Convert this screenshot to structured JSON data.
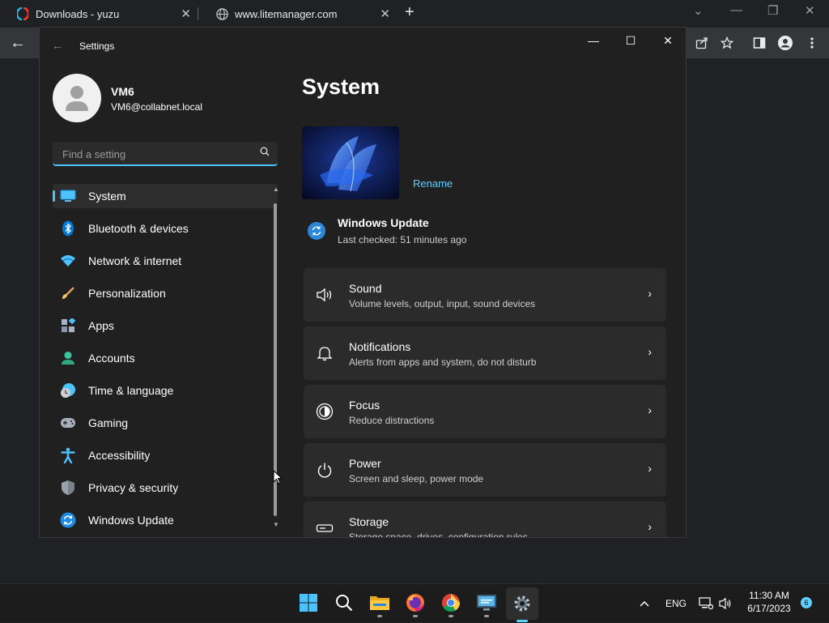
{
  "browser": {
    "tabs": [
      {
        "title": "Downloads - yuzu"
      },
      {
        "title": "www.litemanager.com"
      }
    ],
    "new_tab": "+",
    "window_controls": {
      "dropdown": "⌄",
      "minimize": "—",
      "restore": "❐",
      "close": "✕"
    },
    "tab_close": "✕",
    "back": "←",
    "toolbar_icons": [
      "share-icon",
      "star-icon",
      "sidepanel-icon",
      "profile-icon",
      "menu-icon"
    ]
  },
  "settings": {
    "window_title": "Settings",
    "controls": {
      "minimize": "—",
      "maximize": "☐",
      "close": "✕"
    },
    "user": {
      "name": "VM6",
      "email": "VM6@collabnet.local"
    },
    "search": {
      "placeholder": "Find a setting"
    },
    "nav": [
      {
        "label": "System",
        "icon": "system-icon",
        "active": true
      },
      {
        "label": "Bluetooth & devices",
        "icon": "bluetooth-icon"
      },
      {
        "label": "Network & internet",
        "icon": "network-icon"
      },
      {
        "label": "Personalization",
        "icon": "brush-icon"
      },
      {
        "label": "Apps",
        "icon": "apps-icon"
      },
      {
        "label": "Accounts",
        "icon": "accounts-icon"
      },
      {
        "label": "Time & language",
        "icon": "clock-globe-icon"
      },
      {
        "label": "Gaming",
        "icon": "gamepad-icon"
      },
      {
        "label": "Accessibility",
        "icon": "accessibility-icon"
      },
      {
        "label": "Privacy & security",
        "icon": "shield-icon"
      },
      {
        "label": "Windows Update",
        "icon": "update-icon"
      }
    ],
    "page": {
      "title": "System",
      "rename": "Rename",
      "update": {
        "title": "Windows Update",
        "subtitle": "Last checked: 51 minutes ago"
      },
      "cards": [
        {
          "title": "Sound",
          "subtitle": "Volume levels, output, input, sound devices",
          "icon": "speaker-icon"
        },
        {
          "title": "Notifications",
          "subtitle": "Alerts from apps and system, do not disturb",
          "icon": "bell-icon"
        },
        {
          "title": "Focus",
          "subtitle": "Reduce distractions",
          "icon": "focus-icon"
        },
        {
          "title": "Power",
          "subtitle": "Screen and sleep, power mode",
          "icon": "power-icon"
        },
        {
          "title": "Storage",
          "subtitle": "Storage space, drives, configuration rules",
          "icon": "storage-icon"
        }
      ]
    }
  },
  "taskbar": {
    "apps": [
      "start-icon",
      "search-icon",
      "file-explorer-icon",
      "firefox-icon",
      "chrome-icon",
      "remote-desktop-icon",
      "settings-icon"
    ],
    "tray": {
      "language": "ENG",
      "time": "11:30 AM",
      "date": "6/17/2023",
      "notification_count": "6"
    }
  }
}
